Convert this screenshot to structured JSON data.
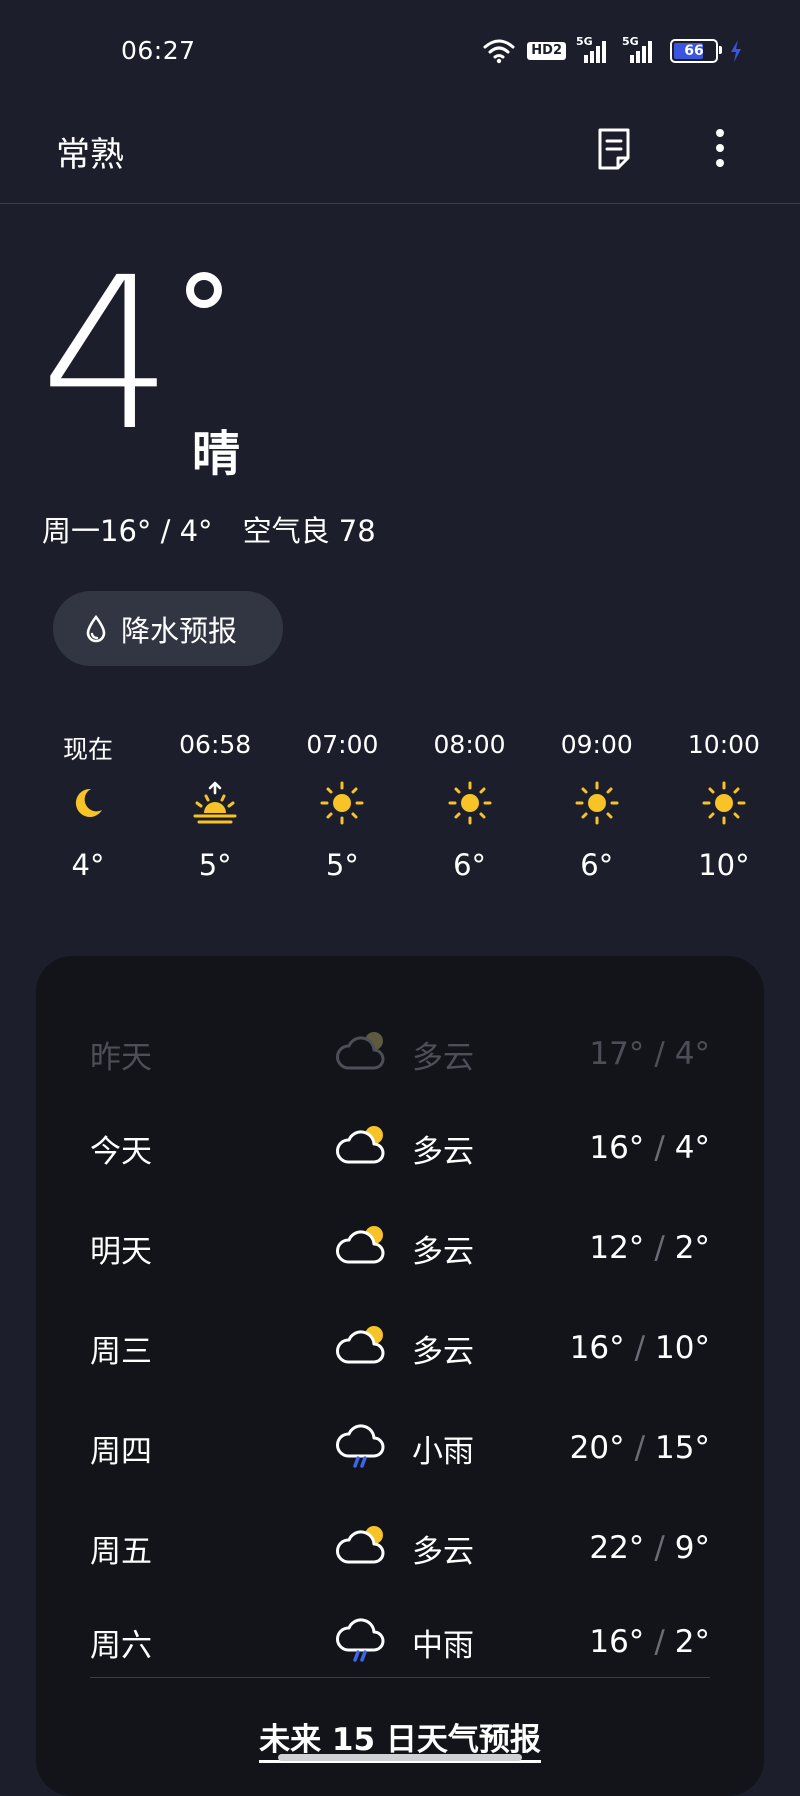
{
  "status_bar": {
    "time": "06:27",
    "hd": "HD2",
    "signal1": "5G",
    "signal2": "5G",
    "battery": "66"
  },
  "header": {
    "city": "常熟"
  },
  "current": {
    "temp": "4",
    "condition": "晴",
    "day_range": "周一16° / 4°",
    "air": "空气良 78"
  },
  "precip_button": {
    "label": "降水预报"
  },
  "hourly": [
    {
      "time": "现在",
      "icon": "moon-icon",
      "temp": "4°"
    },
    {
      "time": "06:58",
      "icon": "sunrise-icon",
      "temp": "5°"
    },
    {
      "time": "07:00",
      "icon": "sun-icon",
      "temp": "5°"
    },
    {
      "time": "08:00",
      "icon": "sun-icon",
      "temp": "6°"
    },
    {
      "time": "09:00",
      "icon": "sun-icon",
      "temp": "6°"
    },
    {
      "time": "10:00",
      "icon": "sun-icon",
      "temp": "10°"
    }
  ],
  "daily": [
    {
      "day": "昨天",
      "icon": "partly-cloudy-icon",
      "cond": "多云",
      "high": "17°",
      "low": "4°"
    },
    {
      "day": "今天",
      "icon": "partly-cloudy-icon",
      "cond": "多云",
      "high": "16°",
      "low": "4°"
    },
    {
      "day": "明天",
      "icon": "partly-cloudy-icon",
      "cond": "多云",
      "high": "12°",
      "low": "2°"
    },
    {
      "day": "周三",
      "icon": "partly-cloudy-icon",
      "cond": "多云",
      "high": "16°",
      "low": "10°"
    },
    {
      "day": "周四",
      "icon": "rain-icon",
      "cond": "小雨",
      "high": "20°",
      "low": "15°"
    },
    {
      "day": "周五",
      "icon": "partly-cloudy-icon",
      "cond": "多云",
      "high": "22°",
      "low": "9°"
    },
    {
      "day": "周六",
      "icon": "rain-icon",
      "cond": "中雨",
      "high": "16°",
      "low": "2°"
    }
  ],
  "daily_sep": "/",
  "more_link": "未来 15 日天气预报",
  "colors": {
    "background": "#1c1f2b",
    "card": "#121419",
    "sun": "#f7c326",
    "rain": "#3a66e8"
  }
}
